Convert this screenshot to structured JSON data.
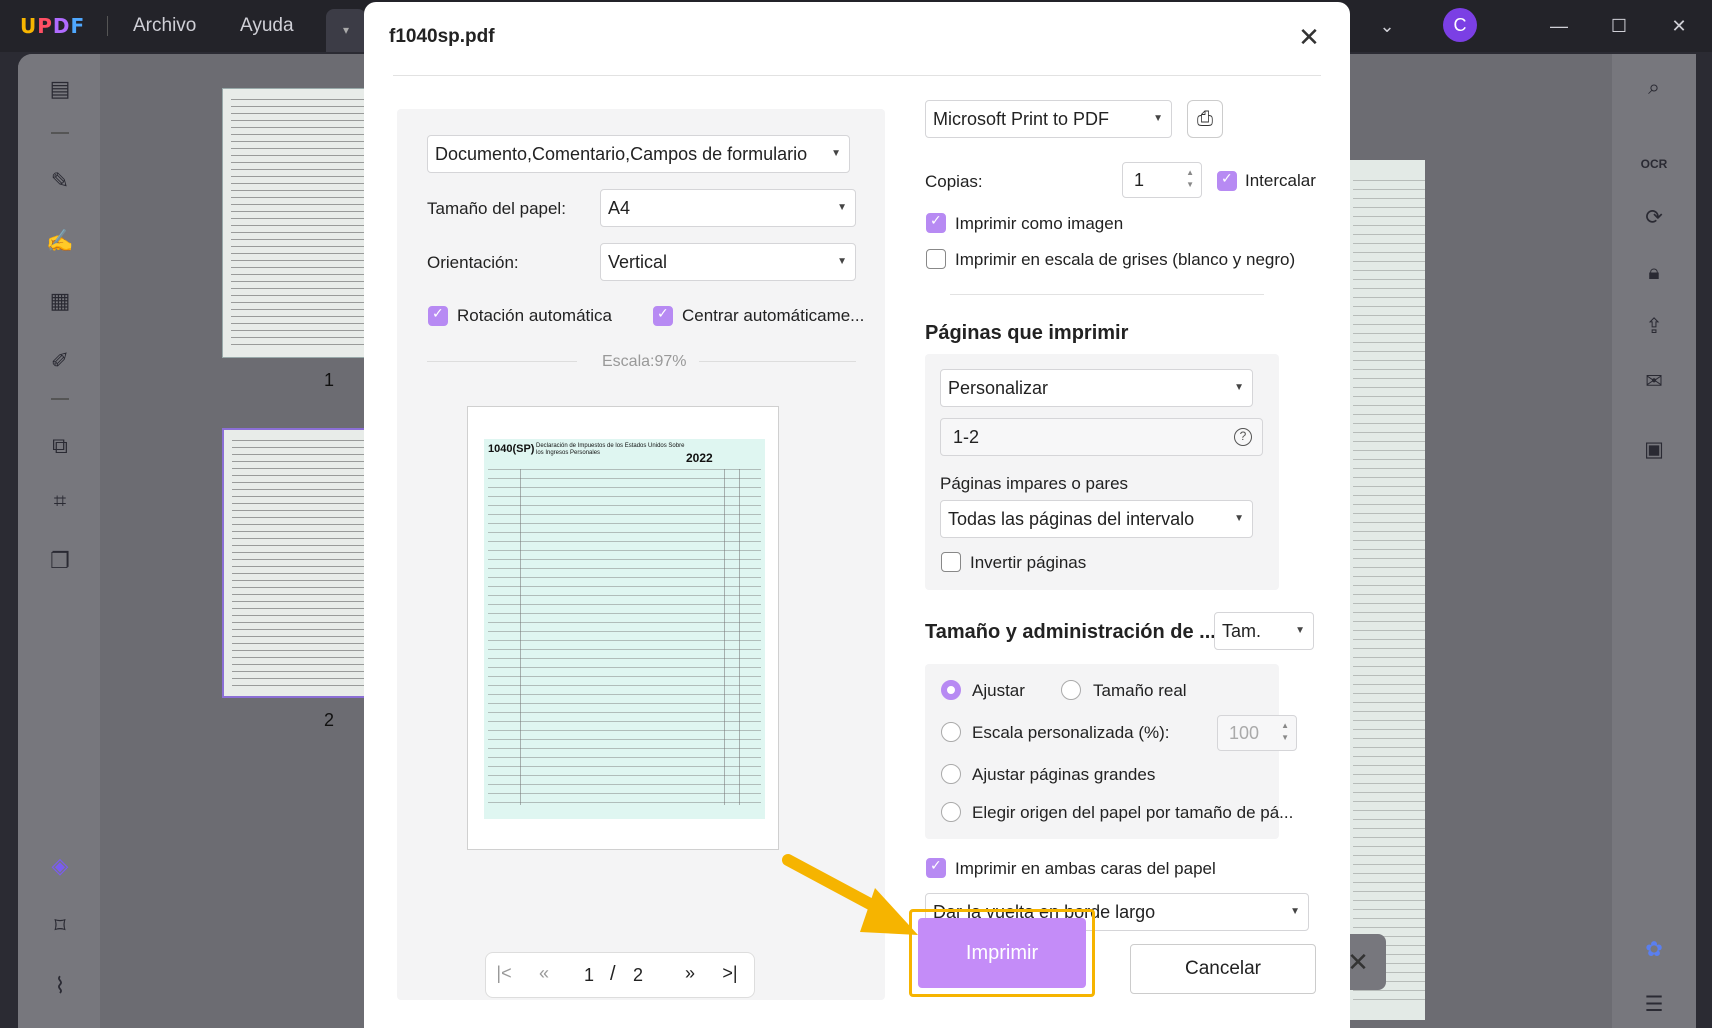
{
  "app": {
    "logo": "UPDF",
    "menu": [
      "Archivo",
      "Ayuda"
    ],
    "avatar_letter": "C",
    "accent_color": "#b78af3",
    "highlight_color": "#f6b400"
  },
  "thumbnails": [
    {
      "page_label": "1"
    },
    {
      "page_label": "2"
    }
  ],
  "dialog": {
    "title": "f1040sp.pdf",
    "left": {
      "content_select": "Documento,Comentario,Campos de formulario",
      "paper_size_label": "Tamaño del papel:",
      "paper_size_value": "A4",
      "orientation_label": "Orientación:",
      "orientation_value": "Vertical",
      "auto_rotate_label": "Rotación automática",
      "auto_rotate_checked": true,
      "auto_center_label": "Centrar automáticame...",
      "auto_center_checked": true,
      "scale_text": "Escala:97%",
      "preview": {
        "form_code": "1040(SP)",
        "form_title": "Declaración de Impuestos de los Estados Unidos Sobre los Ingresos Personales",
        "form_year": "2022"
      },
      "pager": {
        "current": "1",
        "separator": "/",
        "total": "2"
      }
    },
    "right": {
      "printer": "Microsoft Print to PDF",
      "copies_label": "Copias:",
      "copies_value": "1",
      "collate_label": "Intercalar",
      "collate_checked": true,
      "print_as_image_label": "Imprimir como imagen",
      "print_as_image_checked": true,
      "grayscale_label": "Imprimir en escala de grises (blanco y negro)",
      "grayscale_checked": false,
      "pages_section_title": "Páginas que imprimir",
      "pages_mode": "Personalizar",
      "pages_range": "1-2",
      "odd_even_label": "Páginas impares o pares",
      "odd_even_value": "Todas las páginas del intervalo",
      "reverse_label": "Invertir páginas",
      "reverse_checked": false,
      "size_section_title": "Tamaño y administración de ...",
      "size_mode_select": "Tam.",
      "fit_label": "Ajustar",
      "actual_size_label": "Tamaño real",
      "custom_scale_label": "Escala personalizada (%):",
      "custom_scale_value": "100",
      "shrink_label": "Ajustar páginas grandes",
      "paper_source_label": "Elegir origen del papel por tamaño de pá...",
      "selected_size_option": "Ajustar",
      "duplex_label": "Imprimir en ambas caras del papel",
      "duplex_checked": true,
      "flip_value": "Dar la vuelta en borde largo",
      "print_button": "Imprimir",
      "cancel_button": "Cancelar"
    }
  }
}
